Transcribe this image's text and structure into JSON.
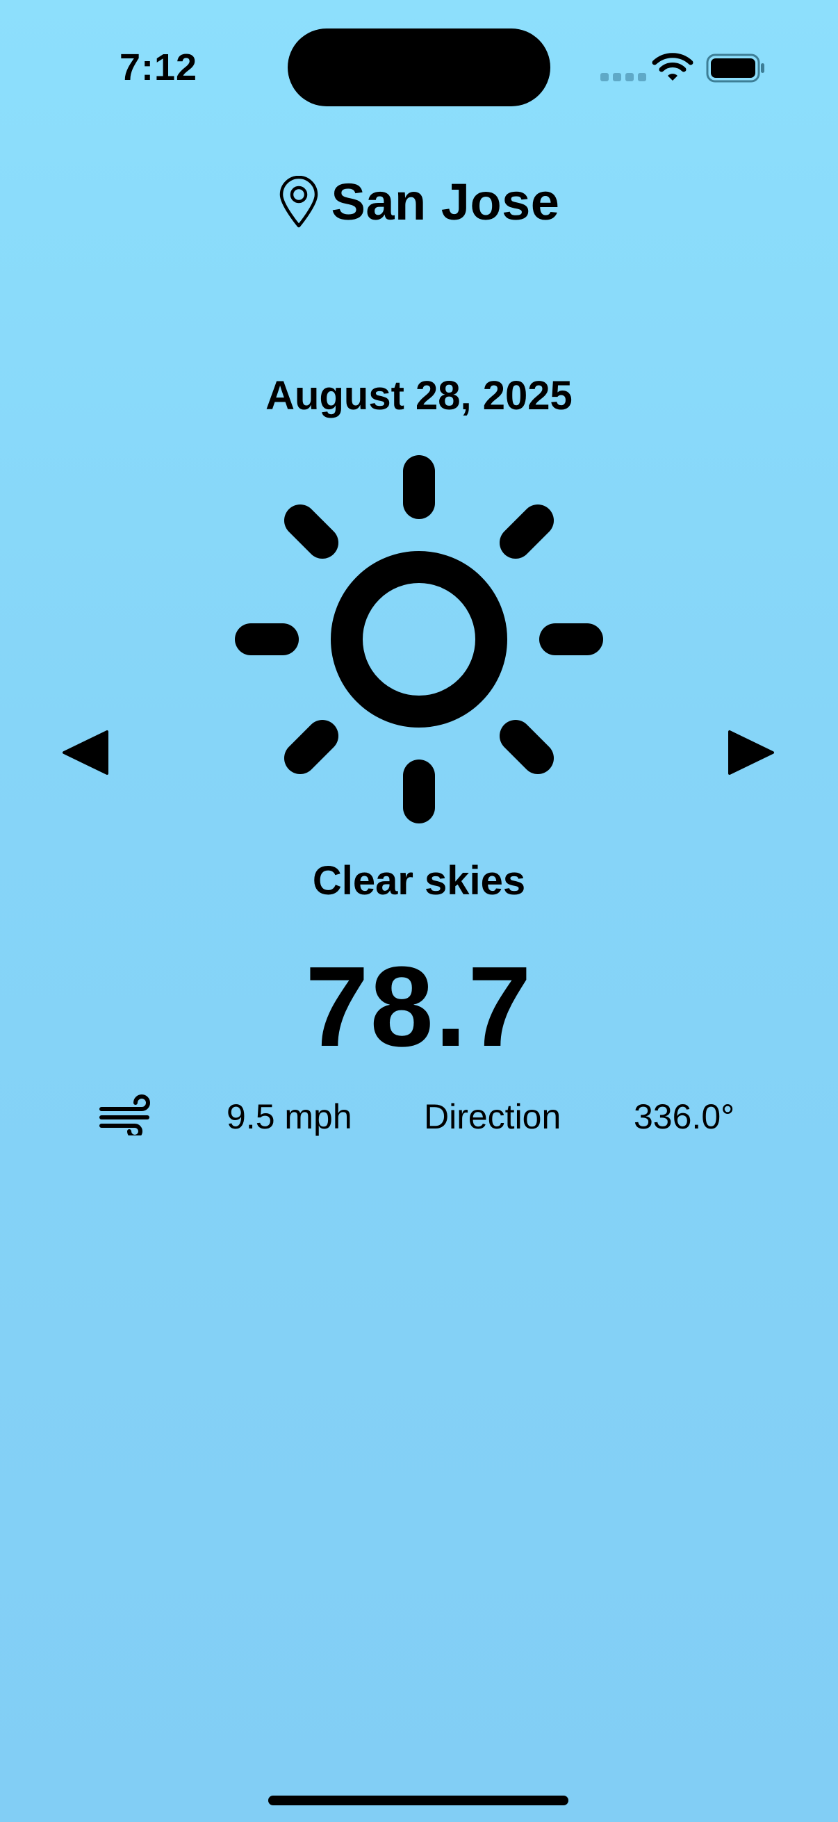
{
  "status_bar": {
    "time": "7:12",
    "wifi_icon": "wifi-icon",
    "battery_icon": "battery-icon"
  },
  "location": {
    "icon": "map-pin-icon",
    "name": "San Jose"
  },
  "date": "August 28, 2025",
  "weather": {
    "icon": "sun-icon",
    "condition": "Clear skies",
    "temperature": "78.7"
  },
  "navigation": {
    "prev_icon": "triangle-left-icon",
    "next_icon": "triangle-right-icon"
  },
  "wind": {
    "icon": "wind-icon",
    "speed": "9.5 mph",
    "direction_label": "Direction",
    "direction_value": "336.0°"
  },
  "colors": {
    "background_top": "#8ddffc",
    "background_bottom": "#82cef5",
    "foreground": "#000000"
  }
}
